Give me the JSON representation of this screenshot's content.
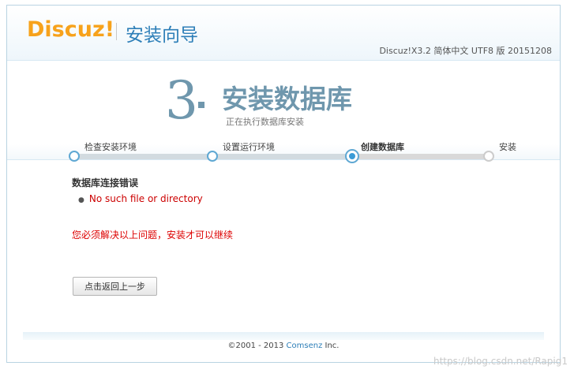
{
  "header": {
    "logo_main": "Discuz",
    "logo_bang": "!",
    "title": "安装向导",
    "version": "Discuz!X3.2 简体中文 UTF8 版 20151208"
  },
  "current_step": {
    "number": "3",
    "heading": "安装数据库",
    "subtitle": "正在执行数据库安装"
  },
  "steps": [
    {
      "label": "检查安装环境",
      "state": "done"
    },
    {
      "label": "设置运行环境",
      "state": "done"
    },
    {
      "label": "创建数据库",
      "state": "current"
    },
    {
      "label": "安装",
      "state": "todo"
    }
  ],
  "error": {
    "title": "数据库连接错误",
    "items": [
      "No such file or directory"
    ],
    "note": "您必须解决以上问题，安装才可以继续"
  },
  "buttons": {
    "back_label": "点击返回上一步"
  },
  "footer": {
    "copyright": "©2001 - 2013 ",
    "brand": "Comsenz",
    "suffix": " Inc."
  },
  "watermark": "https://blog.csdn.net/Rapig1",
  "colors": {
    "accent": "#2e7fb8",
    "logo": "#f7a21b",
    "step_heading": "#6f97ad",
    "error": "#cc0000"
  }
}
